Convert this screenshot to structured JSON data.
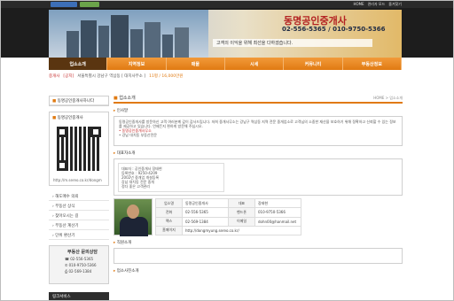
{
  "topbar": {
    "links": [
      "HOME",
      "관리자 모드",
      "즐겨찾기"
    ]
  },
  "banner": {
    "title": "동명공인중개사",
    "phones": "02-556-5365 / 010-9750-5366",
    "tagline": "고객의 이익을 위해 최선을 다하겠습니다."
  },
  "nav": {
    "items": [
      "업소소개",
      "지역정보",
      "매물",
      "시세",
      "커뮤니티",
      "부동산정보"
    ]
  },
  "ticker": {
    "prefix": "중개사",
    "tag": "[공지]",
    "text": "서울특별시 강남구 역삼동 [ 대치사무소 ]",
    "price": "11평 / 16,000만원"
  },
  "sidebar": {
    "section_title": "동명공인중개사하나다",
    "qr_label": "동명공인중개사",
    "qr_url": "http://m.sereo.co.kr/dongm",
    "menu": [
      "해도매수 의뢰",
      "부동산 상식",
      "찾아오시는 길",
      "부동산 계산기",
      "단위 환산기"
    ],
    "contact": {
      "title": "부동산 문의상담",
      "tel": "02-556-5365",
      "mobile": "010-9750-5366",
      "fax": "02-569-1384"
    },
    "link_box": "링크서비스"
  },
  "main": {
    "header": "업소소개",
    "breadcrumb": "HOME > 업소소개",
    "intro_title": "인사말",
    "intro_text": "동명공인중개사를 방문하신 고객 여러분께 깊이 감사드립니다. 저희 중개사무소는 강남구 역삼동 지역 전문 중개업소로 고객님의 소중한 재산을 보호하기 위해 정확하고 신뢰할 수 있는 정보를 제공하고 있습니다. 언제든지 편하게 방문해 주십시오.",
    "intro_red": "• 동명공인중개사무소",
    "intro_foot": "• 강남 대치동 부동산전문",
    "card_title": "대표자소개",
    "card_lines": [
      "대표자 : 공인중개사 장태현",
      "등록번호 : 9250-4209",
      "2002년 중개업 개설등록",
      "강남 대치동 전문 중개",
      "정다 좋은 고객관리"
    ],
    "table": {
      "rows": [
        [
          "업소명",
          "동명공인중개사",
          "대표",
          "장태현"
        ],
        [
          "전화",
          "02-556-5365",
          "핸드폰",
          "010-9750-5366"
        ],
        [
          "팩스",
          "02-569-1384",
          "이메일",
          "dohn00@hanmail.net"
        ],
        [
          "홈페이지",
          "http://dongmyung.sereo.co.kr/",
          "",
          ""
        ]
      ]
    },
    "sec3": "직원소개",
    "sec4": "업소사진소개"
  }
}
